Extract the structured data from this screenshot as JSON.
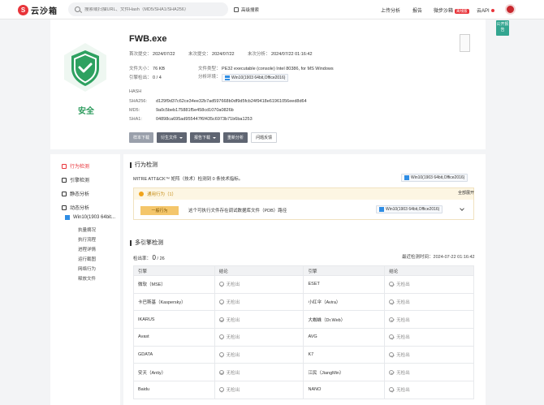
{
  "topbar": {
    "logo_mark": "S",
    "logo_text": "云沙箱",
    "search_placeholder": "搜索或扫描URL、文件Hash（MD5/SHA1/SHA256）",
    "advanced_search": "高级搜索",
    "nav_upload": "上传分析",
    "nav_report": "报告",
    "nav_sync": "微步沙箱",
    "nav_sync_badge": "离线版",
    "nav_api": "云API",
    "public_report": "公开报告"
  },
  "header": {
    "filename": "FWB.exe",
    "safe_label": "安全",
    "first_submit_label": "首次提交：",
    "first_submit": "2024/07/22",
    "last_submit_label": "末次提交：",
    "last_submit": "2024/07/22",
    "last_analysis_label": "末次分析：",
    "last_analysis": "2024/07/22 01:16:42",
    "size_label": "文件大小：",
    "size": "76 KB",
    "type_label": "文件类型：",
    "type": "PE32 executable (console) Intel 80386, for MS Windows",
    "engine_label": "引擎检出：",
    "engine": "0 / 4",
    "env_label": "分析环境：",
    "env": "Win10(1903 64bit,Office2016)",
    "hash_label": "HASH",
    "sha256_label": "SHA256:",
    "sha256": "d129f9d37c62ce34ee32b7ad597668b0df9d5fcb24f9418e61961056eed8d64",
    "md5_label": "MD5:",
    "md5": "9a0c5beb175881f5e458cd1070a0826b",
    "sha1_label": "SHA1:",
    "sha1": "04898ca695ad955447f6f435c6973b71b6ba1253",
    "buttons": {
      "download": "样本下载",
      "derived": "衍生文件",
      "report_download": "报告下载",
      "reanalyze": "重新分析",
      "feedback": "问题反馈"
    }
  },
  "sidebar": {
    "behavior": "行为检测",
    "engine": "引擎检测",
    "static": "静态分析",
    "dynamic": "动态分析",
    "env": "Win10(1903 64bit...",
    "subs": [
      "执量摘况",
      "执行流程",
      "进程详情",
      "运行截图",
      "网络行为",
      "释放文件"
    ]
  },
  "behavior": {
    "title": "行为检测",
    "mitre": "MITRE ATT&CK™ 矩阵（技术）检测到 0 条技术指标。",
    "env": "Win10(1903 64bit,Office2016)",
    "group": "通用行为（1）",
    "expand_all": "全部展开",
    "tag": "一般行为",
    "desc": "这个可执行文件存在调试数据库文件（PDB）路径",
    "row_env": "Win10(1903 64bit,Office2016)"
  },
  "engines": {
    "title": "多引擎检测",
    "detected_label": "检出率：",
    "detected": "0",
    "total": "/ 26",
    "last_label": "最近检测时间：",
    "last_time": "2024-07-22 01:16:42",
    "col_engine": "引擎",
    "col_result": "结论",
    "not_detected": "无检出",
    "rows": [
      [
        "微软（MSE）",
        "ESET"
      ],
      [
        "卡巴斯基（Kaspersky）",
        "小红伞（Avira）"
      ],
      [
        "IKARUS",
        "大蜘蛛（Dr.Web）"
      ],
      [
        "Avast",
        "AVG"
      ],
      [
        "GDATA",
        "K7"
      ],
      [
        "安天（Antiy）",
        "江民（JiangMin）"
      ],
      [
        "Baidu",
        "NANO"
      ]
    ]
  }
}
